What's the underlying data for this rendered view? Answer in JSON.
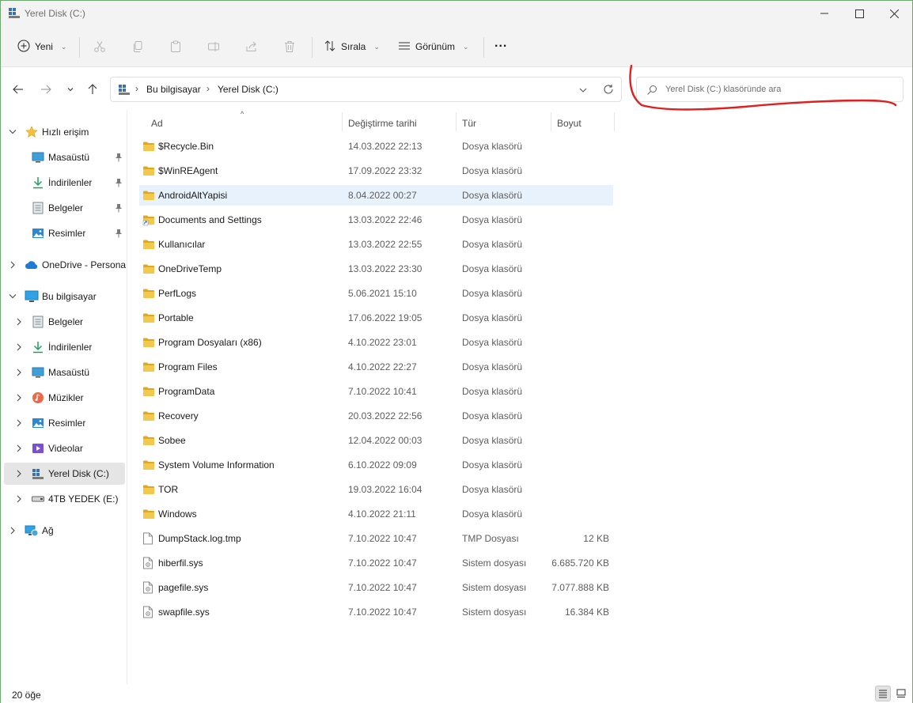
{
  "window": {
    "title": "Yerel Disk (C:)"
  },
  "toolbar": {
    "new_label": "Yeni",
    "sort_label": "Sırala",
    "view_label": "Görünüm",
    "more_label": "..."
  },
  "address": {
    "crumbs": [
      "Bu bilgisayar",
      "Yerel Disk (C:)"
    ],
    "search_placeholder": "Yerel Disk (C:) klasöründe ara"
  },
  "sidebar": {
    "quick_access": "Hızlı erişim",
    "quick_items": [
      "Masaüstü",
      "İndirilenler",
      "Belgeler",
      "Resimler"
    ],
    "onedrive": "OneDrive - Personal",
    "this_pc": "Bu bilgisayar",
    "pc_items": [
      "Belgeler",
      "İndirilenler",
      "Masaüstü",
      "Müzikler",
      "Resimler",
      "Videolar",
      "Yerel Disk (C:)",
      "4TB YEDEK (E:)"
    ],
    "network": "Ağ"
  },
  "columns": {
    "name": "Ad",
    "date": "Değiştirme tarihi",
    "type": "Tür",
    "size": "Boyut"
  },
  "files": [
    {
      "name": "$Recycle.Bin",
      "date": "14.03.2022 22:13",
      "type": "Dosya klasörü",
      "size": ""
    },
    {
      "name": "$WinREAgent",
      "date": "17.09.2022 23:32",
      "type": "Dosya klasörü",
      "size": ""
    },
    {
      "name": "AndroidAltYapisi",
      "date": "8.04.2022 00:27",
      "type": "Dosya klasörü",
      "size": ""
    },
    {
      "name": "Documents and Settings",
      "date": "13.03.2022 22:46",
      "type": "Dosya klasörü",
      "size": ""
    },
    {
      "name": "Kullanıcılar",
      "date": "13.03.2022 22:55",
      "type": "Dosya klasörü",
      "size": ""
    },
    {
      "name": "OneDriveTemp",
      "date": "13.03.2022 23:30",
      "type": "Dosya klasörü",
      "size": ""
    },
    {
      "name": "PerfLogs",
      "date": "5.06.2021 15:10",
      "type": "Dosya klasörü",
      "size": ""
    },
    {
      "name": "Portable",
      "date": "17.06.2022 19:05",
      "type": "Dosya klasörü",
      "size": ""
    },
    {
      "name": "Program Dosyaları (x86)",
      "date": "4.10.2022 23:01",
      "type": "Dosya klasörü",
      "size": ""
    },
    {
      "name": "Program Files",
      "date": "4.10.2022 22:27",
      "type": "Dosya klasörü",
      "size": ""
    },
    {
      "name": "ProgramData",
      "date": "7.10.2022 10:41",
      "type": "Dosya klasörü",
      "size": ""
    },
    {
      "name": "Recovery",
      "date": "20.03.2022 22:56",
      "type": "Dosya klasörü",
      "size": ""
    },
    {
      "name": "Sobee",
      "date": "12.04.2022 00:03",
      "type": "Dosya klasörü",
      "size": ""
    },
    {
      "name": "System Volume Information",
      "date": "6.10.2022 09:09",
      "type": "Dosya klasörü",
      "size": ""
    },
    {
      "name": "TOR",
      "date": "19.03.2022 16:04",
      "type": "Dosya klasörü",
      "size": ""
    },
    {
      "name": "Windows",
      "date": "4.10.2022 21:11",
      "type": "Dosya klasörü",
      "size": ""
    },
    {
      "name": "DumpStack.log.tmp",
      "date": "7.10.2022 10:47",
      "type": "TMP Dosyası",
      "size": "12 KB"
    },
    {
      "name": "hiberfil.sys",
      "date": "7.10.2022 10:47",
      "type": "Sistem dosyası",
      "size": "6.685.720 KB"
    },
    {
      "name": "pagefile.sys",
      "date": "7.10.2022 10:47",
      "type": "Sistem dosyası",
      "size": "7.077.888 KB"
    },
    {
      "name": "swapfile.sys",
      "date": "7.10.2022 10:47",
      "type": "Sistem dosyası",
      "size": "16.384 KB"
    }
  ],
  "status": {
    "item_count": "20 öğe"
  },
  "colors": {
    "folder": "#f2c94c",
    "folder_dark": "#e0a820",
    "hover_row": "#e8f2fc",
    "annotation_red": "#e02020",
    "accent": "#0067c0"
  }
}
